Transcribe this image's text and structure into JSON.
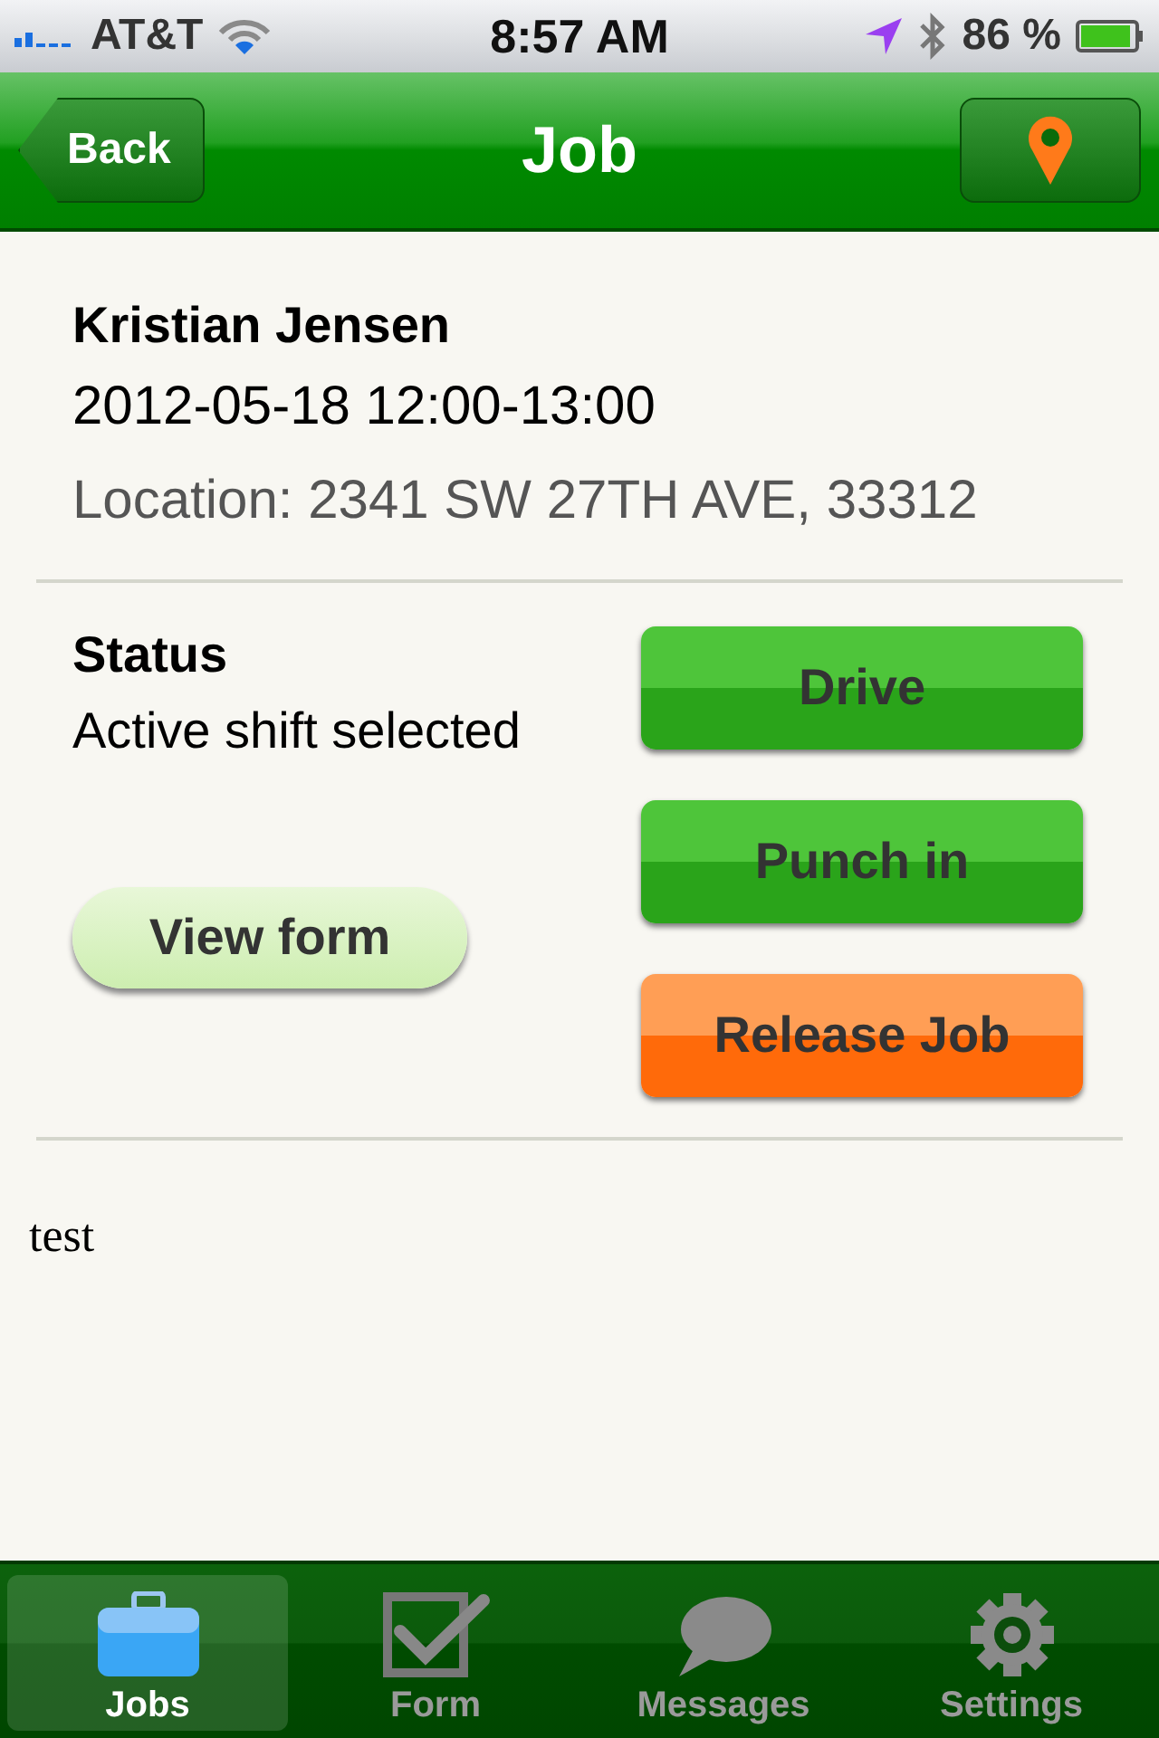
{
  "status_bar": {
    "carrier": "AT&T",
    "time": "8:57 AM",
    "battery": "86 %"
  },
  "nav": {
    "back": "Back",
    "title": "Job"
  },
  "job": {
    "name": "Kristian Jensen",
    "time": "2012-05-18 12:00-13:00",
    "location": "Location: 2341 SW 27TH AVE, 33312"
  },
  "status": {
    "heading": "Status",
    "text": "Active shift selected",
    "view_form": "View form"
  },
  "actions": [
    {
      "label": "Drive",
      "kind": "go"
    },
    {
      "label": "Punch in",
      "kind": "go"
    },
    {
      "label": "Release Job",
      "kind": "release"
    }
  ],
  "note": "test",
  "tabs": [
    {
      "label": "Jobs",
      "kind": "jobs",
      "selected": true
    },
    {
      "label": "Form",
      "kind": "form",
      "selected": false
    },
    {
      "label": "Messages",
      "kind": "messages",
      "selected": false
    },
    {
      "label": "Settings",
      "kind": "settings",
      "selected": false
    }
  ]
}
